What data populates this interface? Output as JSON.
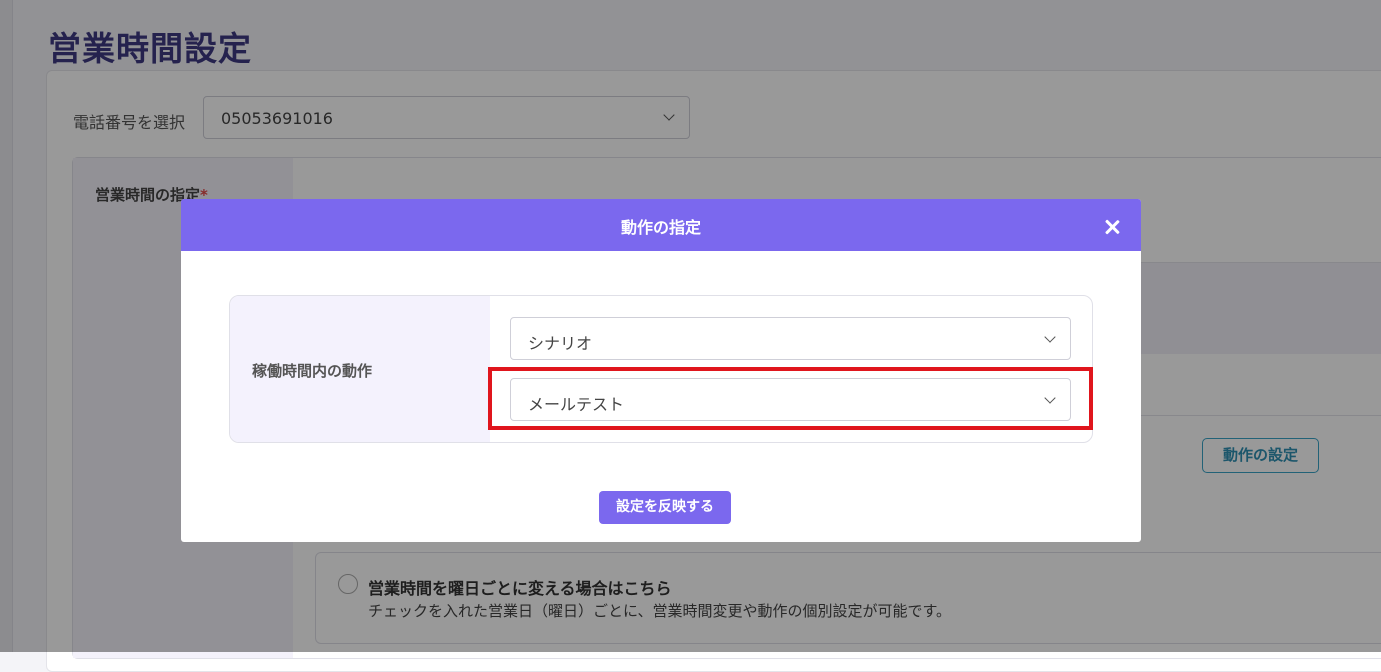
{
  "page": {
    "title": "営業時間設定"
  },
  "phone": {
    "label": "電話番号を選択",
    "value": "05053691016"
  },
  "form": {
    "hours_label": "営業時間の指定",
    "required_mark": "*"
  },
  "background": {
    "action_button_label": "動作の設定",
    "weekday_option": {
      "title": "営業時間を曜日ごとに変える場合はこちら",
      "description": "チェックを入れた営業日（曜日）ごとに、営業時間変更や動作の個別設定が可能です。"
    }
  },
  "modal": {
    "title": "動作の指定",
    "row_label": "稼働時間内の動作",
    "action_type": "シナリオ",
    "scenario": "メールテスト",
    "apply_button": "設定を反映する"
  },
  "colors": {
    "accent": "#7b68ee",
    "highlight": "#e0151d",
    "title": "#3f3a82"
  },
  "icons": [
    "close-icon",
    "chevron-down-icon"
  ]
}
